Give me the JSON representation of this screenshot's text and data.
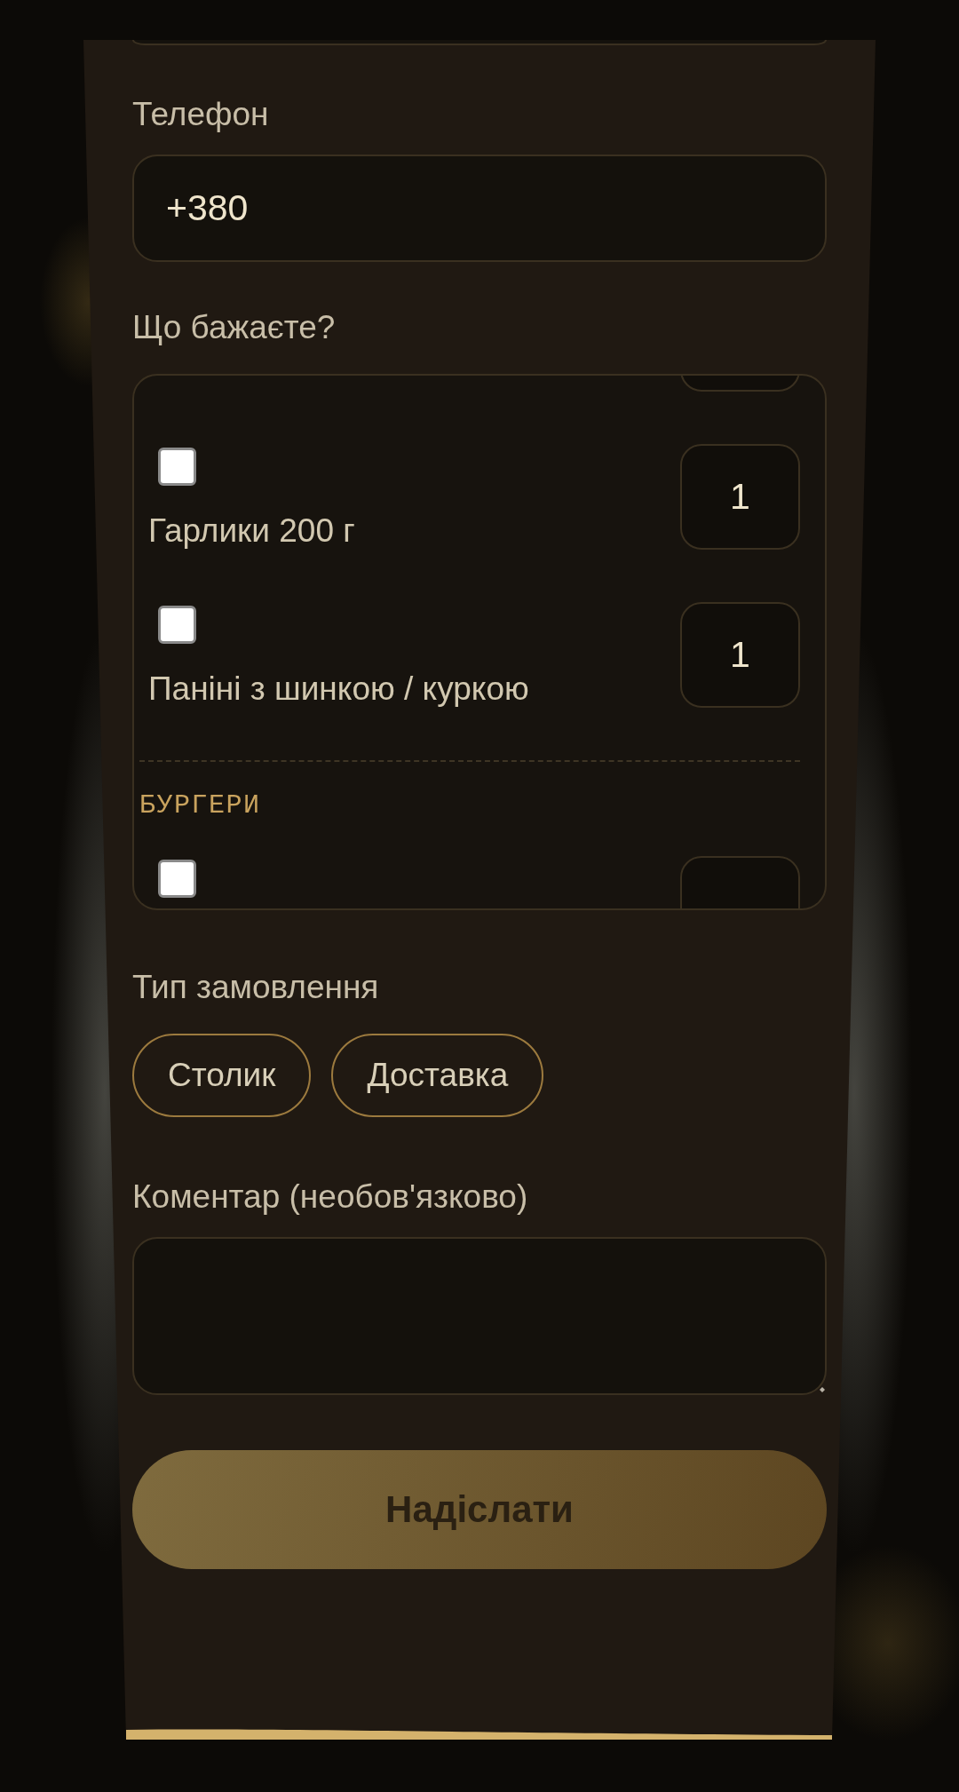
{
  "form": {
    "fields": [
      {
        "kind": "cut"
      },
      {
        "kind": "input",
        "label": "Телефон",
        "value": "+380"
      },
      {
        "kind": "menu",
        "label": "Що бажаєте?",
        "sections": [
          {
            "items": [
              {
                "kind": "clipped"
              },
              {
                "kind": "row",
                "checked": false,
                "name": "Гарлики 200 г",
                "quantity": "1"
              },
              {
                "kind": "row",
                "checked": false,
                "name": "Паніні з шинкою / куркою",
                "quantity": "1"
              }
            ]
          },
          {
            "title": "БУРГЕРИ",
            "items": [
              {
                "kind": "row",
                "checked": false
              }
            ]
          }
        ]
      },
      {
        "kind": "choice",
        "label": "Тип замовлення",
        "options": [
          {
            "label": "Столик",
            "selected": false
          },
          {
            "label": "Доставка",
            "selected": false
          }
        ]
      },
      {
        "kind": "textarea",
        "label": "Коментар (необов'язково)"
      }
    ],
    "submit": {
      "label": "Надіслати"
    }
  }
}
